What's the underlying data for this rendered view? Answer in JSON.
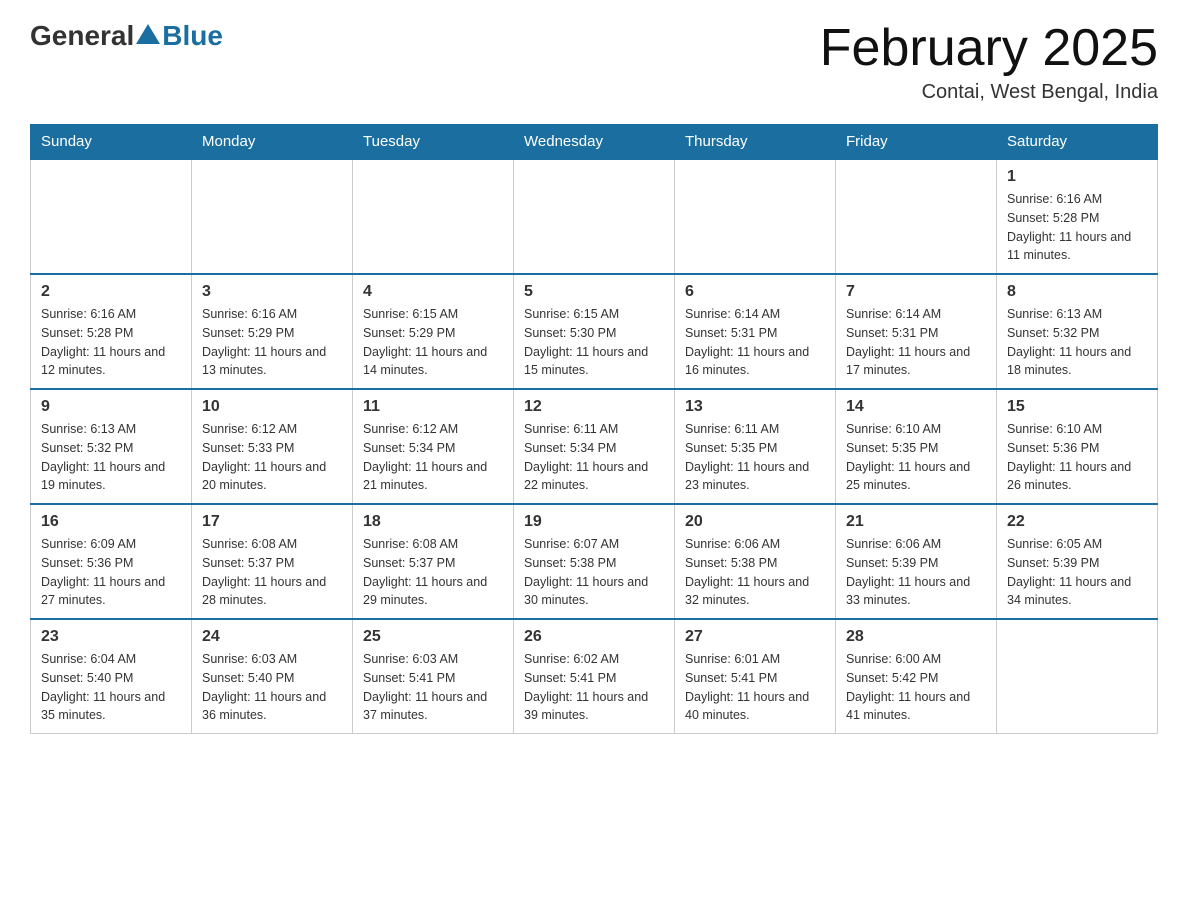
{
  "header": {
    "logo_general": "General",
    "logo_blue": "Blue",
    "month_title": "February 2025",
    "location": "Contai, West Bengal, India"
  },
  "days_of_week": [
    "Sunday",
    "Monday",
    "Tuesday",
    "Wednesday",
    "Thursday",
    "Friday",
    "Saturday"
  ],
  "weeks": [
    [
      {
        "day": "",
        "info": ""
      },
      {
        "day": "",
        "info": ""
      },
      {
        "day": "",
        "info": ""
      },
      {
        "day": "",
        "info": ""
      },
      {
        "day": "",
        "info": ""
      },
      {
        "day": "",
        "info": ""
      },
      {
        "day": "1",
        "info": "Sunrise: 6:16 AM\nSunset: 5:28 PM\nDaylight: 11 hours and 11 minutes."
      }
    ],
    [
      {
        "day": "2",
        "info": "Sunrise: 6:16 AM\nSunset: 5:28 PM\nDaylight: 11 hours and 12 minutes."
      },
      {
        "day": "3",
        "info": "Sunrise: 6:16 AM\nSunset: 5:29 PM\nDaylight: 11 hours and 13 minutes."
      },
      {
        "day": "4",
        "info": "Sunrise: 6:15 AM\nSunset: 5:29 PM\nDaylight: 11 hours and 14 minutes."
      },
      {
        "day": "5",
        "info": "Sunrise: 6:15 AM\nSunset: 5:30 PM\nDaylight: 11 hours and 15 minutes."
      },
      {
        "day": "6",
        "info": "Sunrise: 6:14 AM\nSunset: 5:31 PM\nDaylight: 11 hours and 16 minutes."
      },
      {
        "day": "7",
        "info": "Sunrise: 6:14 AM\nSunset: 5:31 PM\nDaylight: 11 hours and 17 minutes."
      },
      {
        "day": "8",
        "info": "Sunrise: 6:13 AM\nSunset: 5:32 PM\nDaylight: 11 hours and 18 minutes."
      }
    ],
    [
      {
        "day": "9",
        "info": "Sunrise: 6:13 AM\nSunset: 5:32 PM\nDaylight: 11 hours and 19 minutes."
      },
      {
        "day": "10",
        "info": "Sunrise: 6:12 AM\nSunset: 5:33 PM\nDaylight: 11 hours and 20 minutes."
      },
      {
        "day": "11",
        "info": "Sunrise: 6:12 AM\nSunset: 5:34 PM\nDaylight: 11 hours and 21 minutes."
      },
      {
        "day": "12",
        "info": "Sunrise: 6:11 AM\nSunset: 5:34 PM\nDaylight: 11 hours and 22 minutes."
      },
      {
        "day": "13",
        "info": "Sunrise: 6:11 AM\nSunset: 5:35 PM\nDaylight: 11 hours and 23 minutes."
      },
      {
        "day": "14",
        "info": "Sunrise: 6:10 AM\nSunset: 5:35 PM\nDaylight: 11 hours and 25 minutes."
      },
      {
        "day": "15",
        "info": "Sunrise: 6:10 AM\nSunset: 5:36 PM\nDaylight: 11 hours and 26 minutes."
      }
    ],
    [
      {
        "day": "16",
        "info": "Sunrise: 6:09 AM\nSunset: 5:36 PM\nDaylight: 11 hours and 27 minutes."
      },
      {
        "day": "17",
        "info": "Sunrise: 6:08 AM\nSunset: 5:37 PM\nDaylight: 11 hours and 28 minutes."
      },
      {
        "day": "18",
        "info": "Sunrise: 6:08 AM\nSunset: 5:37 PM\nDaylight: 11 hours and 29 minutes."
      },
      {
        "day": "19",
        "info": "Sunrise: 6:07 AM\nSunset: 5:38 PM\nDaylight: 11 hours and 30 minutes."
      },
      {
        "day": "20",
        "info": "Sunrise: 6:06 AM\nSunset: 5:38 PM\nDaylight: 11 hours and 32 minutes."
      },
      {
        "day": "21",
        "info": "Sunrise: 6:06 AM\nSunset: 5:39 PM\nDaylight: 11 hours and 33 minutes."
      },
      {
        "day": "22",
        "info": "Sunrise: 6:05 AM\nSunset: 5:39 PM\nDaylight: 11 hours and 34 minutes."
      }
    ],
    [
      {
        "day": "23",
        "info": "Sunrise: 6:04 AM\nSunset: 5:40 PM\nDaylight: 11 hours and 35 minutes."
      },
      {
        "day": "24",
        "info": "Sunrise: 6:03 AM\nSunset: 5:40 PM\nDaylight: 11 hours and 36 minutes."
      },
      {
        "day": "25",
        "info": "Sunrise: 6:03 AM\nSunset: 5:41 PM\nDaylight: 11 hours and 37 minutes."
      },
      {
        "day": "26",
        "info": "Sunrise: 6:02 AM\nSunset: 5:41 PM\nDaylight: 11 hours and 39 minutes."
      },
      {
        "day": "27",
        "info": "Sunrise: 6:01 AM\nSunset: 5:41 PM\nDaylight: 11 hours and 40 minutes."
      },
      {
        "day": "28",
        "info": "Sunrise: 6:00 AM\nSunset: 5:42 PM\nDaylight: 11 hours and 41 minutes."
      },
      {
        "day": "",
        "info": ""
      }
    ]
  ]
}
